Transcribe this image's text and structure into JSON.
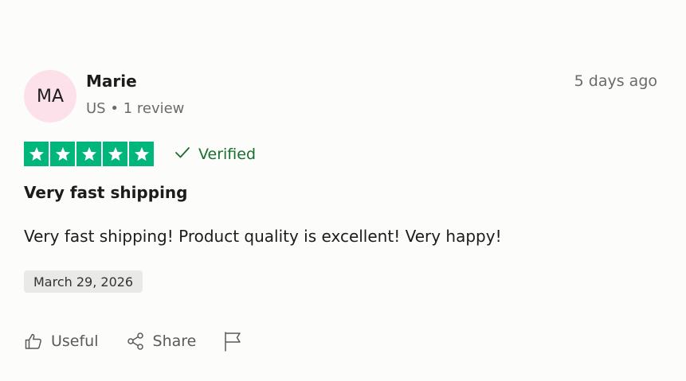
{
  "reviewer": {
    "initials": "MA",
    "name": "Marie",
    "country": "US",
    "separator": "•",
    "review_count": "1 review",
    "avatar_color": "#fce0ea"
  },
  "review": {
    "time_ago": "5 days ago",
    "rating": 5,
    "max_rating": 5,
    "star_color": "#00b67a",
    "verified_label": "Verified",
    "title": "Very fast shipping",
    "body": "Very fast shipping! Product quality is excellent! Very happy!",
    "date": "March 29, 2026"
  },
  "actions": {
    "useful_label": "Useful",
    "share_label": "Share"
  }
}
